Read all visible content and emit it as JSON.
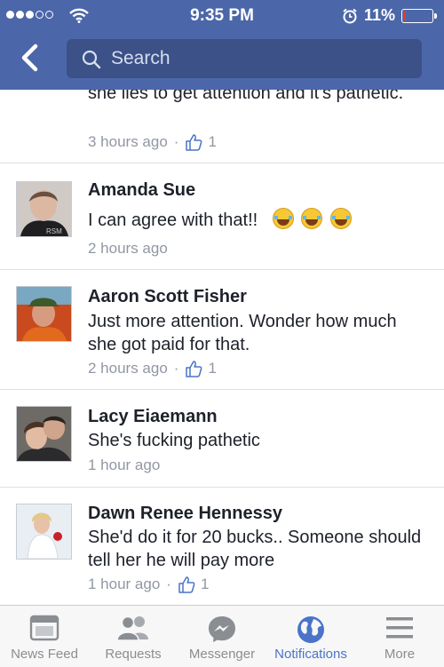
{
  "status_bar": {
    "time": "9:35 PM",
    "battery_percent": "11%",
    "battery_level": 0.11,
    "signal_bars": 3
  },
  "nav": {
    "search_placeholder": "Search"
  },
  "comments": [
    {
      "author": "",
      "text": "she lies to get attention and it's pathetic.",
      "time": "3 hours ago",
      "likes": "1"
    },
    {
      "author": "Amanda Sue",
      "text": "I can agree with that!!",
      "emoji_count": 3,
      "emoji_name": "tears-of-joy-emoji",
      "time": "2 hours ago",
      "likes": ""
    },
    {
      "author": "Aaron Scott Fisher",
      "text": "Just more attention. Wonder how much she got paid for that.",
      "time": "2 hours ago",
      "likes": "1"
    },
    {
      "author": "Lacy Eiaemann",
      "text": "She's fucking pathetic",
      "time": "1 hour ago",
      "likes": ""
    },
    {
      "author": "Dawn Renee Hennessy",
      "text": "She'd do it for 20 bucks.. Someone should tell her he will pay more",
      "time": "1 hour ago",
      "likes": "1"
    }
  ],
  "tabs": [
    {
      "label": "News Feed",
      "icon": "news-feed-icon",
      "active": false
    },
    {
      "label": "Requests",
      "icon": "friend-requests-icon",
      "active": false
    },
    {
      "label": "Messenger",
      "icon": "messenger-icon",
      "active": false
    },
    {
      "label": "Notifications",
      "icon": "globe-icon",
      "active": true
    },
    {
      "label": "More",
      "icon": "menu-icon",
      "active": false
    }
  ],
  "colors": {
    "nav_blue": "#4c67a9",
    "search_bg": "#3b5187",
    "tab_active": "#4a73c9",
    "tab_inactive": "#8a8d91",
    "meta_gray": "#9197a3",
    "battery_red": "#e23a2d"
  }
}
